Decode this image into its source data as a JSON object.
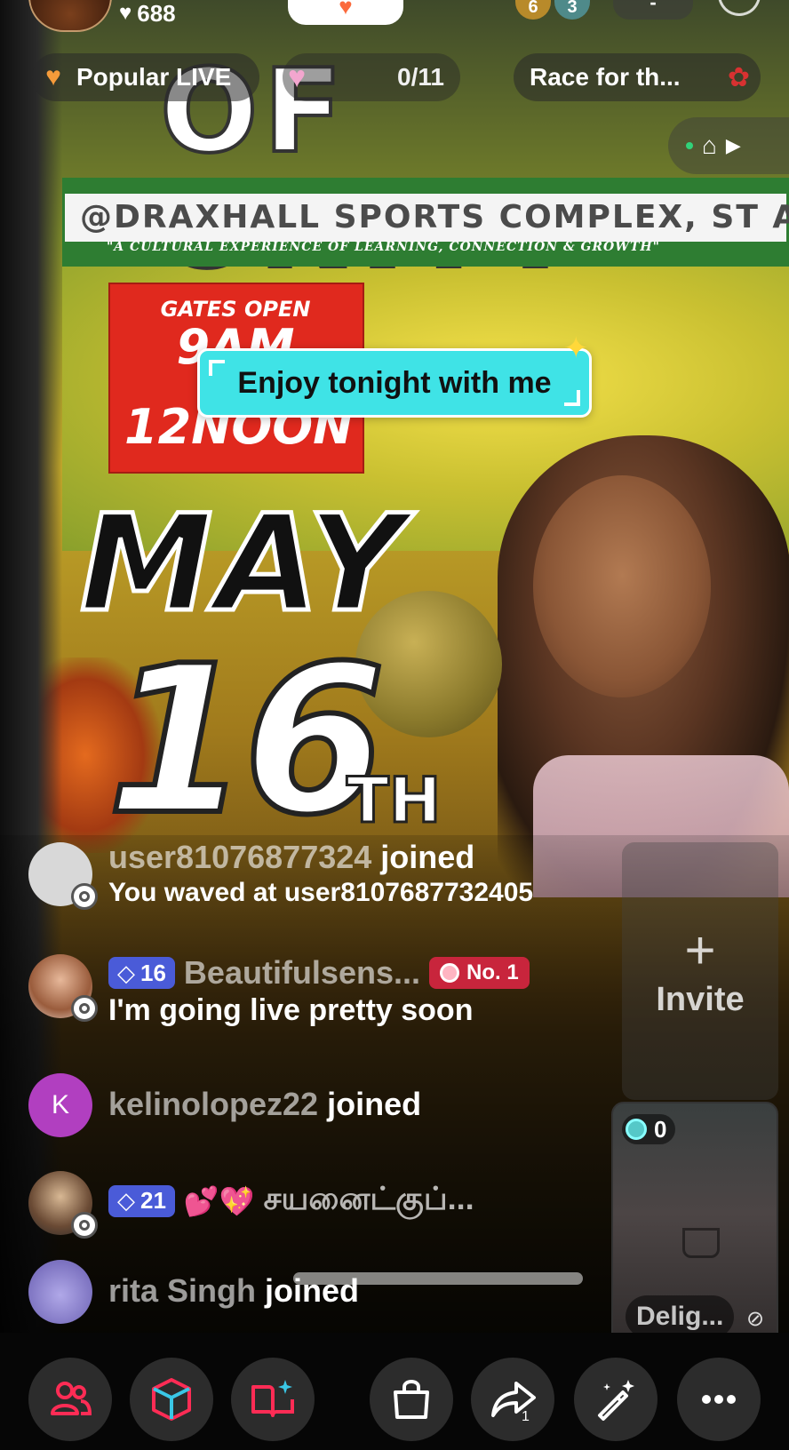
{
  "top_bar": {
    "likes": "688",
    "rank_badges": [
      "6",
      "3"
    ],
    "top_pill": "-"
  },
  "pills": {
    "popular_label": "Popular LIVE",
    "progress": "0/11",
    "race_label": "Race for th..."
  },
  "stream": {
    "poster_title": "OF UNITY",
    "poster_banner": "@DRAXHALL SPORTS COMPLEX, ST AN",
    "poster_tagline": "\"A CULTURAL EXPERIENCE OF LEARNING, CONNECTION & GROWTH\"",
    "poster_gates": [
      "GATES OPEN",
      "9AM",
      "12NOON"
    ],
    "poster_month": "MAY",
    "poster_day": "16",
    "poster_suffix": "TH"
  },
  "enjoy_banner": "Enjoy tonight with me",
  "chat": [
    {
      "user": "user81076877324",
      "action": "joined",
      "message": "You waved at user8107687732405",
      "avatar_color": "#d8d8d8"
    },
    {
      "level": "16",
      "user": "Beautifulsens...",
      "rank": "No. 1",
      "message": "I'm going live pretty soon",
      "avatar_color": "#c9a089"
    },
    {
      "user": "kelinolopez22",
      "action": "joined",
      "avatar_initial": "K",
      "avatar_color": "#b13fc0"
    },
    {
      "level": "21",
      "hearts": "💕💖",
      "message": "சயனைட்குப்...",
      "avatar_color": "#8a6d5a"
    },
    {
      "user": "rita Singh",
      "action": "joined",
      "avatar_color": "#9a8fd0"
    }
  ],
  "invite": {
    "plus": "+",
    "label": "Invite"
  },
  "guest": {
    "count": "0",
    "name": "Delig..."
  },
  "toolbar": {
    "icons": [
      "people-icon",
      "cube-icon",
      "book-sparkle-icon",
      "shopping-bag-icon",
      "share-icon",
      "magic-wand-icon",
      "more-icon"
    ],
    "share_count": "1"
  },
  "colors": {
    "accent_pink": "#fe2c55",
    "banner_cyan": "#3fe3e6",
    "level_badge": "#4a5bd8",
    "rank_badge": "#c8253c"
  }
}
